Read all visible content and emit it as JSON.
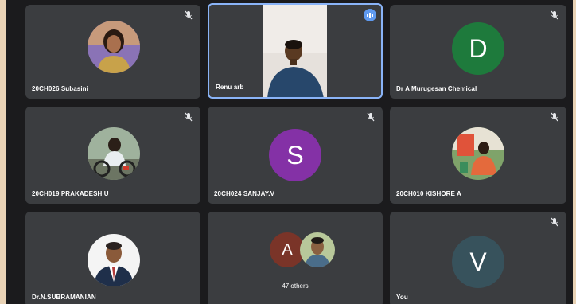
{
  "participants": [
    {
      "name": "20CH026 Subasini"
    },
    {
      "name": "Renu arb"
    },
    {
      "name": "Dr A Murugesan Chemical",
      "initial": "D",
      "color": "#1e7a3c"
    },
    {
      "name": "20CH019 PRAKADESH U"
    },
    {
      "name": "20CH024 SANJAY.V",
      "initial": "S",
      "color": "#8431a6"
    },
    {
      "name": "20CH010 KISHORE A"
    },
    {
      "name": "Dr.N.SUBRAMANIAN"
    },
    {
      "group_initial": "A",
      "group_color": "#7a3428",
      "others_label": "47 others"
    },
    {
      "name": "You",
      "initial": "V",
      "color": "#37525c"
    }
  ],
  "colors": {
    "tile_bg": "#3b3d40",
    "speaking": "#8ab4f8",
    "screen_bg": "#1b1b1d"
  }
}
